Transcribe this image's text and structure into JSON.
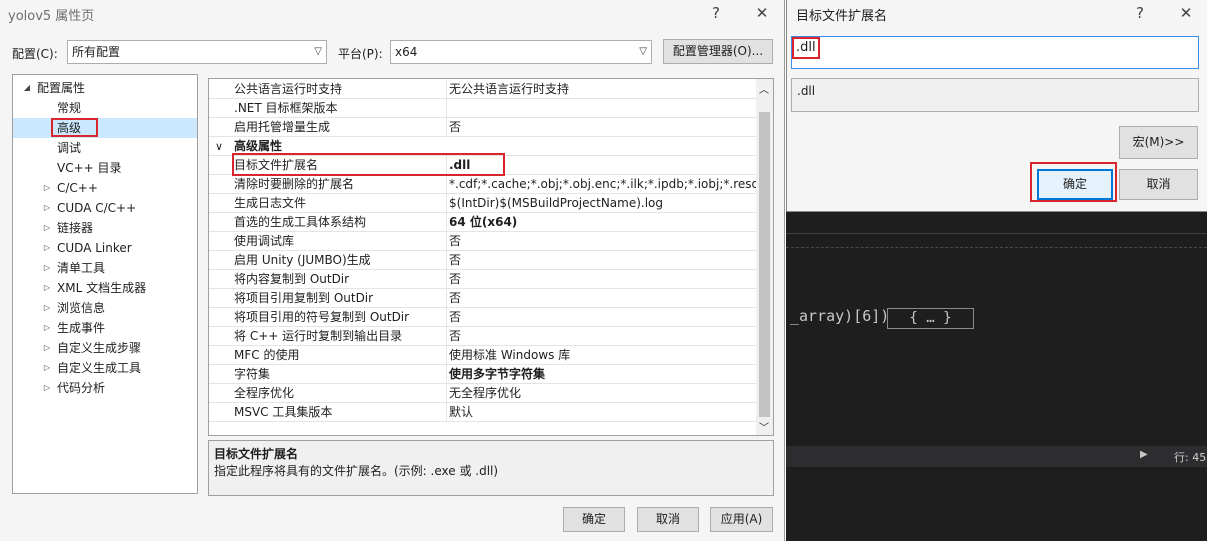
{
  "main_dialog": {
    "title": "yolov5 属性页",
    "help_glyph": "?",
    "close_glyph": "✕",
    "config_label": "配置(C):",
    "config_value": "所有配置",
    "platform_label": "平台(P):",
    "platform_value": "x64",
    "config_manager_button": "配置管理器(O)...",
    "tree": [
      {
        "label": "配置属性",
        "level": 0,
        "arrow": "◢"
      },
      {
        "label": "常规",
        "level": 1,
        "arrow": ""
      },
      {
        "label": "高级",
        "level": 1,
        "arrow": "",
        "selected": true
      },
      {
        "label": "调试",
        "level": 1,
        "arrow": ""
      },
      {
        "label": "VC++ 目录",
        "level": 1,
        "arrow": ""
      },
      {
        "label": "C/C++",
        "level": 1,
        "arrow": "▷"
      },
      {
        "label": "CUDA C/C++",
        "level": 1,
        "arrow": "▷"
      },
      {
        "label": "链接器",
        "level": 1,
        "arrow": "▷"
      },
      {
        "label": "CUDA Linker",
        "level": 1,
        "arrow": "▷"
      },
      {
        "label": "清单工具",
        "level": 1,
        "arrow": "▷"
      },
      {
        "label": "XML 文档生成器",
        "level": 1,
        "arrow": "▷"
      },
      {
        "label": "浏览信息",
        "level": 1,
        "arrow": "▷"
      },
      {
        "label": "生成事件",
        "level": 1,
        "arrow": "▷"
      },
      {
        "label": "自定义生成步骤",
        "level": 1,
        "arrow": "▷"
      },
      {
        "label": "自定义生成工具",
        "level": 1,
        "arrow": "▷"
      },
      {
        "label": "代码分析",
        "level": 1,
        "arrow": "▷"
      }
    ],
    "grid_rows": [
      {
        "name": "公共语言运行时支持",
        "value": "无公共语言运行时支持"
      },
      {
        "name": ".NET 目标框架版本",
        "value": ""
      },
      {
        "name": "启用托管增量生成",
        "value": "否"
      },
      {
        "name": "高级属性",
        "value": "",
        "category": true,
        "arrow": "∨"
      },
      {
        "name": "目标文件扩展名",
        "value": ".dll",
        "bold_value": true
      },
      {
        "name": "清除时要删除的扩展名",
        "value": "*.cdf;*.cache;*.obj;*.obj.enc;*.ilk;*.ipdb;*.iobj;*.resource"
      },
      {
        "name": "生成日志文件",
        "value": "$(IntDir)$(MSBuildProjectName).log"
      },
      {
        "name": "首选的生成工具体系结构",
        "value": "64 位(x64)",
        "bold_value": true
      },
      {
        "name": "使用调试库",
        "value": "否"
      },
      {
        "name": "启用 Unity (JUMBO)生成",
        "value": "否"
      },
      {
        "name": "将内容复制到 OutDir",
        "value": "否"
      },
      {
        "name": "将项目引用复制到 OutDir",
        "value": "否"
      },
      {
        "name": "将项目引用的符号复制到 OutDir",
        "value": "否"
      },
      {
        "name": "将 C++ 运行时复制到输出目录",
        "value": "否"
      },
      {
        "name": "MFC 的使用",
        "value": "使用标准 Windows 库"
      },
      {
        "name": "字符集",
        "value": "使用多字节字符集",
        "bold_value": true
      },
      {
        "name": "全程序优化",
        "value": "无全程序优化"
      },
      {
        "name": "MSVC 工具集版本",
        "value": "默认"
      }
    ],
    "scroll_up": "︿",
    "scroll_down": "﹀",
    "description_title": "目标文件扩展名",
    "description_text": "指定此程序将具有的文件扩展名。(示例: .exe 或 .dll)",
    "ok_button": "确定",
    "cancel_button": "取消",
    "apply_button": "应用(A)"
  },
  "ext_dialog": {
    "title": "目标文件扩展名",
    "help_glyph": "?",
    "close_glyph": "✕",
    "input_value": ".dll",
    "evaluated_value": ".dll",
    "macro_button": "宏(M)>>",
    "ok_button": "确定",
    "cancel_button": "取消"
  },
  "editor": {
    "code_fragment": "_array)[6])",
    "collapsed_braces": "{ … }",
    "status_arrow": "▶",
    "status_text": "行: 45"
  },
  "colors": {
    "selection": "#cce8ff",
    "highlight_red": "#d9262c",
    "accent_blue": "#0078d7",
    "editor_bg": "#1e1e1e"
  }
}
